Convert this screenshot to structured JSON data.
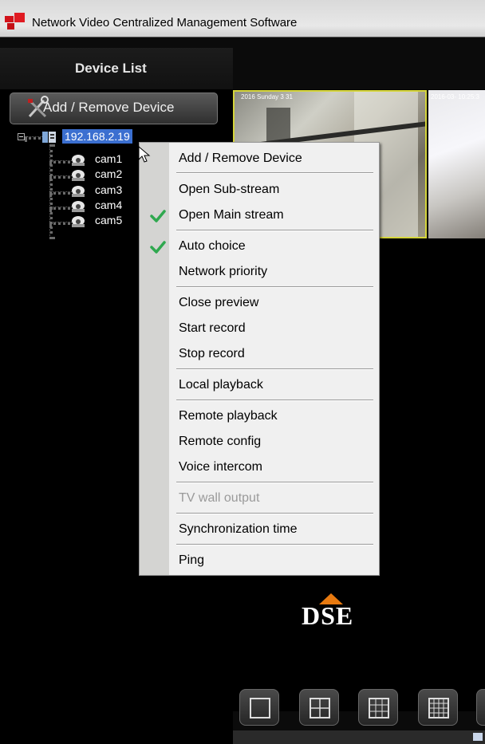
{
  "window": {
    "title": "Network Video Centralized Management Software"
  },
  "sidebar": {
    "header": "Device List",
    "add_remove_button": "Add / Remove Device",
    "device": {
      "label": "192.168.2.19",
      "cameras": [
        "cam1",
        "cam2",
        "cam3",
        "cam4",
        "cam5"
      ]
    }
  },
  "context_menu": {
    "items": [
      {
        "label": "Add / Remove Device",
        "checked": false,
        "enabled": true
      },
      {
        "label": "Open Sub-stream",
        "checked": false,
        "enabled": true
      },
      {
        "label": "Open Main stream",
        "checked": true,
        "enabled": true
      },
      {
        "label": "Auto choice",
        "checked": true,
        "enabled": true
      },
      {
        "label": "Network priority",
        "checked": false,
        "enabled": true
      },
      {
        "label": "Close preview",
        "checked": false,
        "enabled": true
      },
      {
        "label": "Start record",
        "checked": false,
        "enabled": true
      },
      {
        "label": "Stop record",
        "checked": false,
        "enabled": true
      },
      {
        "label": "Local playback",
        "checked": false,
        "enabled": true
      },
      {
        "label": "Remote playback",
        "checked": false,
        "enabled": true
      },
      {
        "label": "Remote config",
        "checked": false,
        "enabled": true
      },
      {
        "label": "Voice intercom",
        "checked": false,
        "enabled": true
      },
      {
        "label": "TV wall output",
        "checked": false,
        "enabled": false
      },
      {
        "label": "Synchronization time",
        "checked": false,
        "enabled": true
      },
      {
        "label": "Ping",
        "checked": false,
        "enabled": true
      }
    ]
  },
  "video": {
    "osd_1": "2016 Sunday 3 31",
    "osd_2": "2016-03-  10:25:3",
    "logo_text": "DSE"
  },
  "layout_buttons": [
    "layout-1x1",
    "layout-2x2",
    "layout-3x3",
    "layout-4x4",
    "layout-more"
  ],
  "colors": {
    "selection": "#3b6fd0",
    "check": "#2fa84f",
    "active_border": "#d5d53a",
    "logo_accent": "#e87a10"
  }
}
